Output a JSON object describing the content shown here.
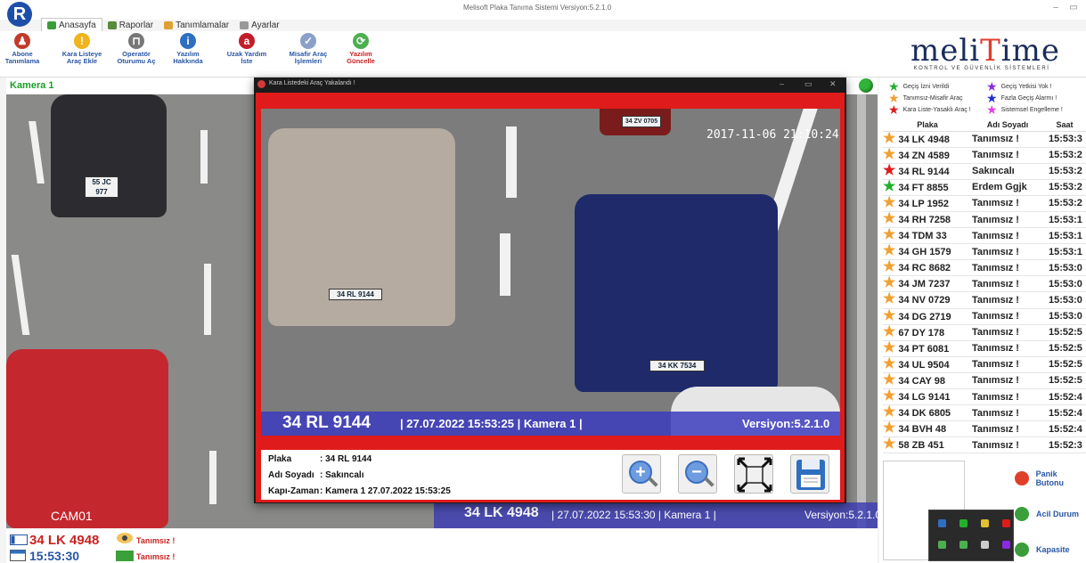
{
  "window": {
    "title": "Melisoft Plaka Tanıma Sistemi  Versiyon:5.2.1.0",
    "minimize": "–",
    "maximize": "▭"
  },
  "menu_tabs": [
    {
      "label": "Anasayfa",
      "active": true,
      "color": "#3a9c3a"
    },
    {
      "label": "Raporlar",
      "active": false,
      "color": "#5a8a3a"
    },
    {
      "label": "Tanımlamalar",
      "active": false,
      "color": "#e0a030"
    },
    {
      "label": "Ayarlar",
      "active": false,
      "color": "#999999"
    }
  ],
  "ribbon": [
    {
      "line1": "Abone",
      "line2": "Tanımlama",
      "icon": "user-icon",
      "glyph": "♟",
      "color": "#c23a2a",
      "red": false
    },
    {
      "line1": "Kara Listeye",
      "line2": "Araç Ekle",
      "icon": "warning-icon",
      "glyph": "!",
      "color": "#f0b41c",
      "red": false
    },
    {
      "line1": "Operatör",
      "line2": "Oturumu Aç",
      "icon": "lock-icon",
      "glyph": "⊓",
      "color": "#777777",
      "red": false
    },
    {
      "line1": "Yazılım",
      "line2": "Hakkında",
      "icon": "info-icon",
      "glyph": "i",
      "color": "#2f6fc0",
      "red": false
    },
    {
      "line1": "Uzak Yardım",
      "line2": "İste",
      "icon": "remote-help-icon",
      "glyph": "a",
      "color": "#c21e2a",
      "red": false
    },
    {
      "line1": "Misafir Araç",
      "line2": "İşlemleri",
      "icon": "guest-car-icon",
      "glyph": "✓",
      "color": "#8aa0c8",
      "red": false
    },
    {
      "line1": "Yazılım",
      "line2": "Güncelle",
      "icon": "update-icon",
      "glyph": "⟳",
      "color": "#4caf50",
      "red": true
    }
  ],
  "brand": {
    "name_pre": "meli",
    "name_hl": "T",
    "name_post": "ime",
    "subtitle": "KONTROL VE GÜVENLİK SİSTEMLERİ"
  },
  "camera": {
    "title": "Kamera 1",
    "label": "CAM01",
    "overlay_plate": "34 LK 4948",
    "overlay_info": "| 27.07.2022 15:53:30 |  Kamera 1 |",
    "overlay_version": "Versiyon:5.2.1.0",
    "visible_plates": [
      "55 JC 977"
    ]
  },
  "popup": {
    "title": "Kara Listedeki Araç Yakalandı !",
    "timestamp": "2017-11-06 21:10:24",
    "plate": "34 RL 9144",
    "info": "| 27.07.2022 15:53:25 |  Kamera 1 |",
    "version": "Versiyon:5.2.1.0",
    "car_plates": [
      "34 RL 9144",
      "34 KK 7534",
      "34 ZV 0705"
    ],
    "details": [
      {
        "key": "Plaka",
        "value": ": 34 RL 9144"
      },
      {
        "key": "Adı Soyadı",
        "value": ": Sakıncalı"
      },
      {
        "key": "Kapı-Zaman",
        "value": ": Kamera 1 27.07.2022 15:53:25"
      }
    ],
    "buttons": {
      "zoom_in": "+",
      "zoom_out": "−"
    }
  },
  "legend": [
    {
      "label": "Geçiş İzni Verildi",
      "color": "#22b02a"
    },
    {
      "label": "Geçiş Yetkisi Yok !",
      "color": "#8a2be2"
    },
    {
      "label": "Tanımsız-Misafir Araç",
      "color": "#f0a030"
    },
    {
      "label": "Fazla Geçiş Alarmı !",
      "color": "#1a2fd0"
    },
    {
      "label": "Kara Liste-Yasaklı Araç !",
      "color": "#e01b1b"
    },
    {
      "label": "Sistemsel Engelleme !",
      "color": "#e040e0"
    }
  ],
  "table": {
    "headers": [
      "Plaka",
      "Adı Soyadı",
      "Saat"
    ],
    "rows": [
      {
        "plate": "34 LK 4948",
        "name": "Tanımsız !",
        "time": "15:53:3",
        "color": "#f0a030"
      },
      {
        "plate": "34 ZN 4589",
        "name": "Tanımsız !",
        "time": "15:53:2",
        "color": "#f0a030"
      },
      {
        "plate": "34 RL 9144",
        "name": "Sakıncalı",
        "time": "15:53:2",
        "color": "#e01b1b"
      },
      {
        "plate": "34 FT 8855",
        "name": "Erdem Ggjk",
        "time": "15:53:2",
        "color": "#22b02a"
      },
      {
        "plate": "34 LP 1952",
        "name": "Tanımsız !",
        "time": "15:53:2",
        "color": "#f0a030"
      },
      {
        "plate": "34 RH 7258",
        "name": "Tanımsız !",
        "time": "15:53:1",
        "color": "#f0a030"
      },
      {
        "plate": "34 TDM 33",
        "name": "Tanımsız !",
        "time": "15:53:1",
        "color": "#f0a030"
      },
      {
        "plate": "34 GH 1579",
        "name": "Tanımsız !",
        "time": "15:53:1",
        "color": "#f0a030"
      },
      {
        "plate": "34 RC 8682",
        "name": "Tanımsız !",
        "time": "15:53:0",
        "color": "#f0a030"
      },
      {
        "plate": "34 JM 7237",
        "name": "Tanımsız !",
        "time": "15:53:0",
        "color": "#f0a030"
      },
      {
        "plate": "34 NV 0729",
        "name": "Tanımsız !",
        "time": "15:53:0",
        "color": "#f0a030"
      },
      {
        "plate": "34 DG 2719",
        "name": "Tanımsız !",
        "time": "15:53:0",
        "color": "#f0a030"
      },
      {
        "plate": "67 DY 178",
        "name": "Tanımsız !",
        "time": "15:52:5",
        "color": "#f0a030"
      },
      {
        "plate": "34 PT 6081",
        "name": "Tanımsız !",
        "time": "15:52:5",
        "color": "#f0a030"
      },
      {
        "plate": "34 UL 9504",
        "name": "Tanımsız !",
        "time": "15:52:5",
        "color": "#f0a030"
      },
      {
        "plate": "34 CAY 98",
        "name": "Tanımsız !",
        "time": "15:52:5",
        "color": "#f0a030"
      },
      {
        "plate": "34 LG 9141",
        "name": "Tanımsız !",
        "time": "15:52:4",
        "color": "#f0a030"
      },
      {
        "plate": "34 DK 6805",
        "name": "Tanımsız !",
        "time": "15:52:4",
        "color": "#f0a030"
      },
      {
        "plate": "34 BVH 48",
        "name": "Tanımsız !",
        "time": "15:52:4",
        "color": "#f0a030"
      },
      {
        "plate": "58 ZB 451",
        "name": "Tanımsız !",
        "time": "15:52:3",
        "color": "#f0a030"
      }
    ]
  },
  "side_buttons": [
    {
      "label": "Panik Butonu",
      "icon": "panic-icon",
      "color": "#e0402a"
    },
    {
      "label": "Acil Durum",
      "icon": "emergency-icon",
      "color": "#3aa03a"
    },
    {
      "label": "Kapasite",
      "icon": "capacity-icon",
      "color": "#3a9c3a"
    }
  ],
  "tray_colors": [
    "#2f6fc0",
    "#22b02a",
    "#e0c030",
    "#e01b1b",
    "#4caf50",
    "#4caf50",
    "#cccccc",
    "#8a2be2"
  ],
  "bottom": {
    "plate": "34 LK 4948",
    "time": "15:53:30",
    "status_1": "Tanımsız !",
    "status_2": "Tanımsız !"
  }
}
